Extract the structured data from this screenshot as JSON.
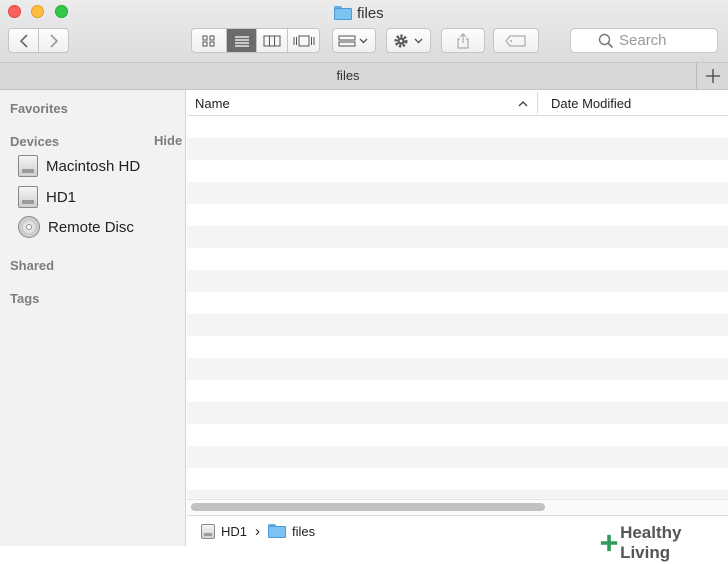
{
  "window": {
    "title": "files"
  },
  "toolbar": {
    "view_modes": [
      "icon-view",
      "list-view",
      "column-view",
      "cover-flow-view"
    ],
    "active_view": "list-view",
    "search_placeholder": "Search"
  },
  "path_bar": {
    "title": "files",
    "add_tab_icon": "plus-icon"
  },
  "sidebar": {
    "favorites_heading": "Favorites",
    "devices_heading": "Devices",
    "devices_hide_label": "Hide",
    "devices": [
      {
        "label": "Macintosh HD",
        "icon": "hard-drive-icon"
      },
      {
        "label": "HD1",
        "icon": "hard-drive-icon"
      },
      {
        "label": "Remote Disc",
        "icon": "disc-icon"
      }
    ],
    "shared_heading": "Shared",
    "tags_heading": "Tags"
  },
  "file_list": {
    "columns": [
      {
        "label": "Name",
        "sort": "ascending"
      },
      {
        "label": "Date Modified"
      }
    ],
    "rows": []
  },
  "status_bar": {
    "path": [
      "HD1",
      "files"
    ],
    "separator": "›"
  },
  "watermark": {
    "text": "Healthy Living"
  },
  "colors": {
    "close": "#fc605c",
    "minimize": "#fdbc40",
    "maximize": "#34c84a",
    "folder": "#7cc2f2",
    "watermark": "#2e9b5b"
  }
}
